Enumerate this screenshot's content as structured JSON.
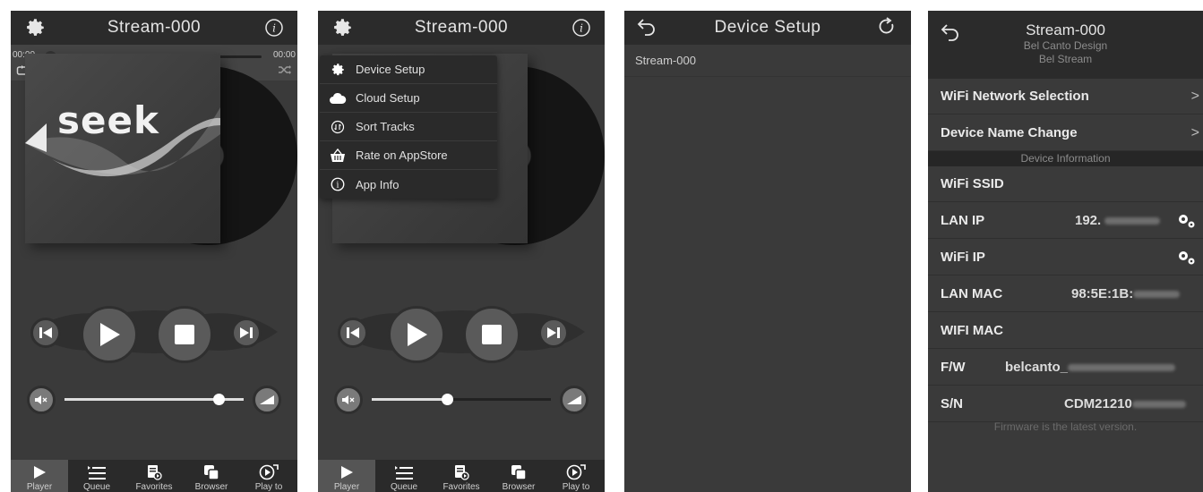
{
  "screen1": {
    "title": "Stream-000",
    "time_elapsed": "00:00",
    "time_total": "00:00",
    "album_text": "seek",
    "progress_fraction": 0,
    "volume_fraction": 0.86,
    "tabs": [
      {
        "label": "Player"
      },
      {
        "label": "Queue"
      },
      {
        "label": "Favorites"
      },
      {
        "label": "Browser"
      },
      {
        "label": "Play to"
      }
    ]
  },
  "screen2": {
    "title": "Stream-000",
    "volume_fraction": 0.42,
    "menu": [
      {
        "label": "Device Setup",
        "icon": "gear-icon"
      },
      {
        "label": "Cloud Setup",
        "icon": "cloud-icon"
      },
      {
        "label": "Sort Tracks",
        "icon": "sort-icon"
      },
      {
        "label": "Rate on AppStore",
        "icon": "basket-icon"
      },
      {
        "label": "App Info",
        "icon": "info-icon"
      }
    ],
    "tabs": [
      {
        "label": "Player"
      },
      {
        "label": "Queue"
      },
      {
        "label": "Favorites"
      },
      {
        "label": "Browser"
      },
      {
        "label": "Play to"
      }
    ]
  },
  "screen3": {
    "title": "Device Setup",
    "devices": [
      "Stream-000"
    ]
  },
  "screen4": {
    "title": "Stream-000",
    "maker": "Bel Canto Design",
    "model": "Bel Stream",
    "wifi_selection": "WiFi Network Selection",
    "name_change": "Device Name Change",
    "section": "Device Information",
    "wifi_ssid": "WiFi SSID",
    "lan_ip": "LAN IP",
    "lan_ip_value": "192.",
    "wifi_ip": "WiFi IP",
    "lan_mac": "LAN MAC",
    "lan_mac_value": "98:5E:1B:",
    "wifi_mac": "WIFI MAC",
    "fw": "F/W",
    "fw_value": "belcanto_",
    "sn": "S/N",
    "sn_value": "CDM21210",
    "note": "Firmware is the latest version."
  },
  "colors": {
    "bar": "#2b2b2b",
    "body": "#3a3a3a",
    "tab_active": "#555555"
  }
}
